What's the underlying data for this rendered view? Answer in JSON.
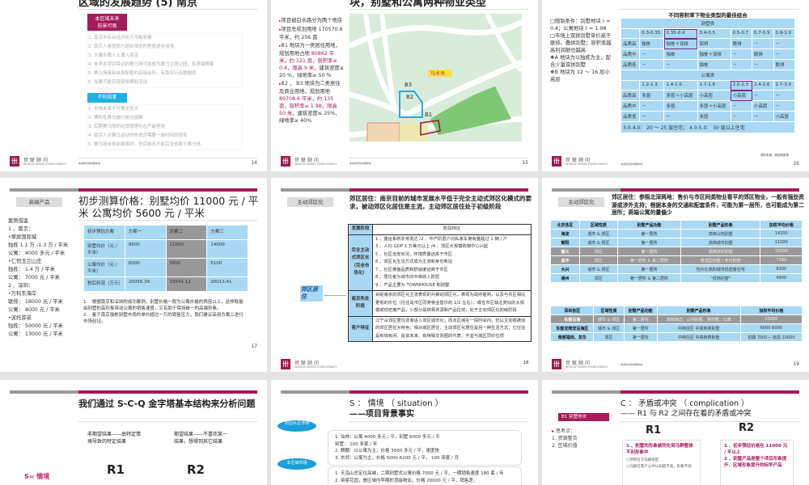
{
  "brand": {
    "logo_cn": "世联顾问",
    "logo_en": "WORLD UNION CONSULTANCY",
    "footer_note": "本资料仅供内部参考"
  },
  "slides": [
    {
      "page": "14",
      "title": "区域的发展趋势 (5) 南京",
      "positive_label_1": "本区域未来",
      "positive_label_2": "前景可观",
      "positive_items": [
        "1. 南京市综合经济实力不断发展",
        "2. 南京人接受西方超前观念的程度逐步加强",
        "3. 大量外籍人士涌入南京",
        "4. 未来本项目旁边的赛马场可能成为赛马主题公园，有表演赛事",
        "5. 赛马场具有自身配套的高级会所，有助实行会籍制度",
        "6. 如果可能实现变相博彩活动"
      ],
      "negative_label": "不利因素",
      "negative_items": [
        "1. 市场未来不可预见性大",
        "2. 博彩性赛马施行相当困难",
        "3. 后期赛马场的经营管理存在严峻考验",
        "4. 南京人对赛马运动的热爱还需要一段时间的培育",
        "5. 赛马场未来前景虽好，但目前还不能完全依赖于赛马场"
      ]
    },
    {
      "page": "15",
      "title": "块，别墅和公寓两种物业类型",
      "bullets": [
        {
          "text": "项目被白水路分为两个地块"
        },
        {
          "text": "项目总规划用地 170570.6 平米，约 256 亩"
        },
        {
          "text": "B1 地块为一类居住用地，规划用地占地 ",
          "highlight": "80862 平米，约 121 亩，容积率≤ 0.4，限高 9 米",
          "tail": "，建筑密度≤ 20 %，绿地率≥ 50 %"
        },
        {
          "text": "B2 、 B3 地块为二类居住及商业用地，规划用地 ",
          "highlight": "89708.6 平米，约 135 亩，容积率≤ 1.98，限高 50 米",
          "tail": "，建筑密度≤ 25%，绿地率≥ 40%"
        }
      ],
      "map": {
        "label_racecourse": "马术场",
        "plots": [
          "B3",
          "B2",
          "B1"
        ]
      }
    },
    {
      "page": "16",
      "left": [
        "□限制条件：别墅地块 r = 0.4；公寓地块 r = 1.98",
        "□市场上双拼别墅单价高于联排、叠拼别墅；容积率越高利润额也越高",
        "❖A 地块为以独栋为主，配合少量双拼别墅",
        "❖B 地块为 12 ～ 16 层小高层"
      ],
      "table_title": "不同容积率下物业类型的最佳组合",
      "villa_header": "别墅类",
      "villa_cols": [
        "0.3-0.35",
        "0.35-0.4",
        "0.4-0.5",
        "0.5-0.7",
        "0.7-0.9",
        "0.9-1.0"
      ],
      "villa_rows": [
        [
          "品质高",
          "独栋",
          "独栋＋双拼",
          "双拼",
          "联排",
          "－",
          "－"
        ],
        [
          "品质中",
          "－",
          "独栋",
          "独栋＋双拼",
          "－",
          "联排",
          "－"
        ],
        [
          "品质低",
          "－",
          "－",
          "独栋",
          "－",
          "－",
          "联排"
        ]
      ],
      "apt_header": "公寓类",
      "apt_cols": [
        "1.2-1.3",
        "1.4-1.6",
        "1.7-1.8",
        "2.0-2.3",
        "2.4-2.6",
        "2.7-3.0"
      ],
      "apt_rows": [
        [
          "品质高",
          "多层",
          "多层＋小高层",
          "小高层",
          "小高层",
          "－",
          "－"
        ],
        [
          "品质中",
          "－",
          "多层",
          "多层＋小高层",
          "－",
          "小高层",
          "－"
        ],
        [
          "品质低",
          "－",
          "－",
          "多层",
          "－",
          "－",
          "小高层"
        ]
      ],
      "footnote": "3.0-4.0： 20 ～ 25 层住宅； 4.0-5.0： 30 层以上住宅",
      "source": "资料来源：规划院推荐"
    },
    {
      "page": "17",
      "tag": "高端产品",
      "title": "初步测算价格：别墅均价 11000 元 / 平米 公寓均价 5600 元 / 平米",
      "left": [
        "案例借鉴",
        "1 、南京：",
        "•翠屏国际城",
        "独栋 1.1 万 -1.3 万 / 平米",
        "公寓： 4000 多元 / 平米",
        "•仁恒玉兰山庄",
        "独栋： 1.4 万 / 平米",
        "公寓： 7000 元 / 平米",
        "2 、深圳：",
        "•万科东海岸",
        "联排： 18000 元 / 平米",
        "公寓： 8000 元 / 平米",
        "•波托菲诺",
        "独栋： 50000 元 / 平米",
        "公寓： 13000 元 / 平米"
      ],
      "table": [
        [
          "初步预估方案",
          "方案一",
          "方案二",
          "方案三"
        ],
        [
          "别墅均价（元 / 平米）",
          "8600",
          "11000",
          "14000"
        ],
        [
          "公寓均价（元 / 平米）",
          "6000",
          "5600",
          "5100"
        ],
        [
          "税后利润（万元）",
          "20058.39",
          "19541.12",
          "20013.41"
        ]
      ],
      "notes": [
        "1.　根据南京和深圳的成功案例，别墅价格一般为公寓价格的两倍以上，这样既能由别墅的高形象带动公寓的销售速度，又有助于保持统一的高端形象。",
        "2.　鉴于南京独栋别墅市场的单价超过一万的销售压力，我们建议采用方案二进行市场验证。"
      ]
    },
    {
      "page": "18",
      "tag": "主动郊区化",
      "title": "郊区居住：南京目前的城市发展水平低于完全主动式郊区化模式的要求，被动郊区化居住是主流，主动郊区居住处于初级阶段",
      "side_label": "郊区居住",
      "table_head": [
        "发展阶段",
        "阶段特征"
      ],
      "stage1": "完全主动式郊区化（完全市场化）",
      "stage1_items": [
        "1 、捷运系统非常发达 /2 、中产阶层户均私家车拥有量超过 1 辆 / 户",
        "3 、人均 GDP 1 万美元以上 /4 、郊区大规模购物中心兴起",
        "5 、社区治安状况、环境质量远高于市区",
        "6 、郊区化生活方式成为主流和身份象征",
        "7 、社区楼盘品质和舒适度远高于市区",
        "8 、居住者为城市的中高收入阶层",
        "9 、产品主要为 TOWNHOUSE 和别墅"
      ],
      "stage2": "南京所处阶段",
      "stage2_text": "目前南京的郊区化主流表现的为被动郊区化，表现为政府催熟，以及与市区相比更低的价位（往往是市区同类物业售价的 1/2 左右），或在市区缺乏类似的大规模或低密度产品，少部分是依靠资源和产品拉动，处于主动郊区化初级阶段",
      "stage3": "客户特征",
      "stage3_text": "江宁从郊区居住逐渐进入郊区城市化；而本区域在一段时间内，仍以主动或被动的郊区居住为特色；相对城区居住，主动郊区化居住是另一种生活方式；它往往是有钱有闲、投资未来、有特殊交际圈的代表，不宜与城区同价位项"
    },
    {
      "page": "19",
      "tag": "主动郊区化",
      "title": "郊区居住：参照北深两地：售价与市区同类物业看平的郊区物业，一般有强劲资源或涉外支持；根据本身的交通和配套条件，可能为第一居所，也可能成为第二居所；高端公寓的量偏少",
      "bj_head": [
        "北京各区",
        "区域性质",
        "别墅产品功能",
        "别墅产品形象",
        "加权平均价格"
      ],
      "bj_rows": [
        [
          "海淀",
          "城市 & 郊区",
          "第一居所",
          "高档山地别墅",
          "14200"
        ],
        [
          "朝阳",
          "城市 & 郊区",
          "第一居所",
          "高档城市别墅",
          "11000"
        ],
        [
          "顺义",
          "郊区",
          "第一居所",
          "高档涉外别墅",
          "10000"
        ],
        [
          "昌平",
          "郊区",
          "第一居所 & 第二居所",
          "景观型别墅 / 乡村别墅",
          "7769"
        ],
        [
          "大兴",
          "城市 & 郊区",
          "第一居所",
          "性价比高的城市低密度住宅",
          "6300"
        ],
        [
          "通州",
          "郊区",
          "第一居所 & 第二居所",
          "“低档别墅”",
          "4900"
        ]
      ],
      "sz_head": [
        "深圳各区",
        "区域性质",
        "别墅产品功能",
        "别墅产品形象",
        "加权平均价格"
      ],
      "sz_rows": [
        [
          "东部沿海",
          "城市 & 郊区",
          "第二居所",
          "高档海边、山地别墅、类别墅、公寓",
          "20000"
        ],
        [
          "东部龙岗非沿海区",
          "城市 & 郊区",
          "第一居所",
          "中档住区 中高档类别墅",
          "6000-8000"
        ],
        [
          "南部福田、龙华",
          "郊区",
          "第一居所",
          "中档住区 中高档类别墅",
          "初期 7000— 目前 10000"
        ]
      ]
    },
    {
      "title": "我们通过 S-C-Q 金字塔基本结构来分析问题",
      "r1_desc": "非期望结果——由特定情境导致的特定结果",
      "r2_desc": "期望结果——不喜欢某一结果，想得到其它结果",
      "r1": "R1",
      "r2": "R2",
      "s_label": "S= 情境"
    },
    {
      "title_1": "S ： 情境 （ situation ）",
      "title_2": "——项目背景事实",
      "bubble_1": "周边片区市场",
      "bubble_2": "本区域市场",
      "box_1": [
        "1. 仙林：公寓 4000 多元 / 平，别墅 6000 多元 / 平",
        "别墅： 100 多套 / 年",
        "2. 麒麟：以公寓为主，价格 3000 多元 / 平，速度快",
        "3. 东郊：公寓为主，价格 5000-6200 元 / 平， 100 来套 / 月"
      ],
      "box_2": [
        "1. 天泓山庄定位高端，二期别墅式公寓价格 7000 元 / 平，一期销售速度 180 套 / 年",
        "2. 帝豪花园，是区域内早期的顶级物业，价格 20000 元 / 平，销售差，"
      ]
    },
    {
      "title_1": "C ： 矛盾或冲突 （ complication ）",
      "title_2": "—— R1 与 R2 之间存在着的矛盾或冲突",
      "tag": "B1 别墅地块",
      "points_head": "思考点：",
      "points": [
        "资源整合",
        "区域价值"
      ],
      "r1": "R1",
      "r2": "R2",
      "r1_main": "1 、别墅的形象被同化到马群整体不利形象中",
      "r1_subs": [
        "□项目位于马群地区",
        "□马群在客户心中认知度不高，形象不高"
      ],
      "r2_items": [
        "1 、初步预估价格在 11000 元 / 平以上",
        "2 、别墅产品是整个项目形象提升、区域形象提升的标竿产品"
      ]
    }
  ],
  "colors": {
    "brand_magenta": "#a51a5a",
    "table_blue": "#a8d8f3",
    "callout_cyan": "#1a9fd9",
    "grey_bar": "#999999"
  }
}
